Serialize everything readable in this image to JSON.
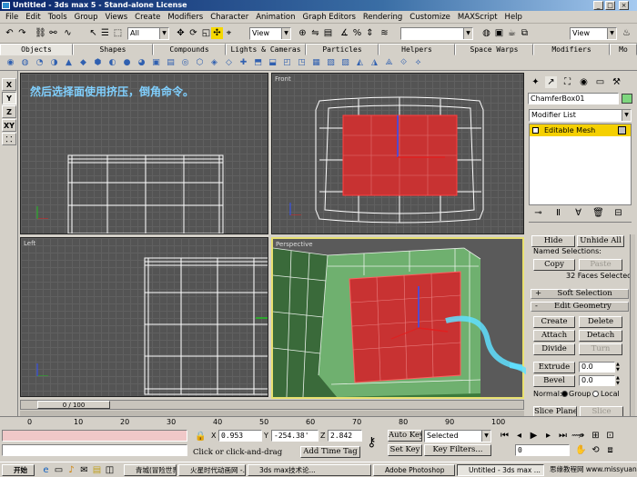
{
  "window": {
    "title": "Untitled - 3ds max 5 - Stand-alone License"
  },
  "menu": [
    "File",
    "Edit",
    "Tools",
    "Group",
    "Views",
    "Create",
    "Modifiers",
    "Character",
    "Animation",
    "Graph Editors",
    "Rendering",
    "Customize",
    "MAXScript",
    "Help"
  ],
  "toolbar": {
    "filter": "All",
    "refcoord": "View",
    "namedsel": "",
    "view2": "View"
  },
  "tabs": [
    "Objects",
    "Shapes",
    "Compounds",
    "Lights & Cameras",
    "Particles",
    "Helpers",
    "Space Warps",
    "Modifiers",
    "Mo"
  ],
  "lefttools": [
    "X",
    "Y",
    "Z",
    "XY"
  ],
  "viewports": {
    "top_left": {
      "label": "",
      "caption": "然后选择面使用挤压，倒角命令。"
    },
    "top_right": {
      "label": "Front"
    },
    "bottom_left": {
      "label": "Left"
    },
    "bottom_right": {
      "label": "Perspective"
    }
  },
  "timeslider": {
    "frame": "0 / 100",
    "ticks": [
      "0",
      "10",
      "20",
      "30",
      "40",
      "50",
      "60",
      "70",
      "80",
      "90",
      "100"
    ]
  },
  "panel": {
    "object_name": "ChamferBox01",
    "modifier_list": "Modifier List",
    "stack_item": "Editable Mesh",
    "hide": "Hide",
    "unhide_all": "Unhide All",
    "named_selections": "Named Selections:",
    "copy": "Copy",
    "paste": "Paste",
    "faces_selected": "32 Faces Selected",
    "soft_selection": "Soft Selection",
    "edit_geometry": "Edit Geometry",
    "create": "Create",
    "delete": "Delete",
    "attach": "Attach",
    "detach": "Detach",
    "divide": "Divide",
    "turn": "Turn",
    "extrude": "Extrude",
    "extrude_value": "0.0",
    "bevel": "Bevel",
    "bevel_value": "0.0",
    "normal": "Normal:",
    "group": "Group",
    "local": "Local",
    "slice_plane": "Slice Plane",
    "slice": "Slice"
  },
  "status": {
    "x_label": "X",
    "x": "0.953",
    "y_label": "Y",
    "y": "-254.38'",
    "z_label": "Z",
    "z": "2.842",
    "prompt": "Click or click-and-drag",
    "add_time_tag": "Add Time Tag",
    "auto_key": "Auto Key",
    "selected": "Selected",
    "set_key": "Set Key",
    "key_filters": "Key Filters...",
    "frame_field": "0"
  },
  "taskbar": {
    "start": "开始",
    "tasks": [
      "青城(冒险世界)>>...",
      "火星时代动画网 -...",
      "3ds max技术论...",
      "Adobe Photoshop",
      "Untitled - 3ds max ..."
    ],
    "watermark": "思缘教程网 www.missyuan.net"
  },
  "colors": {
    "title_bar": "#0a246a",
    "selection": "#c83232",
    "viewport_bg": "#545454",
    "active_border": "#e8e070",
    "caption": "#80d0ff",
    "stack_highlight": "#ffd800"
  }
}
